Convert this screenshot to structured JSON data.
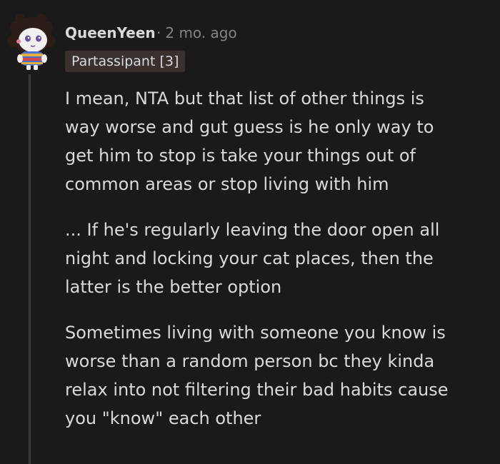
{
  "comment": {
    "author": "QueenYeen",
    "separator": "·",
    "timestamp": "2 mo. ago",
    "flair": "Partassipant [3]",
    "avatar_icon": "snoo-avatar-icon",
    "paragraphs": [
      "I mean, NTA but that list of other things is\nway worse and gut guess is he only way to\nget him to stop is take your things out of\ncommon areas or stop living with him",
      "... If he's regularly leaving the door open all\nnight and locking your cat places, then the\nlatter is the better option",
      "Sometimes living with someone you know is\nworse than a random person bc they kinda\nrelax into not filtering their bad habits cause\nyou \"know\" each other"
    ]
  },
  "colors": {
    "background": "#1a1a1b",
    "text": "#d7dadc",
    "muted": "#818384",
    "flair_bg": "#3a302d",
    "thread_line": "#3c3c3e"
  }
}
